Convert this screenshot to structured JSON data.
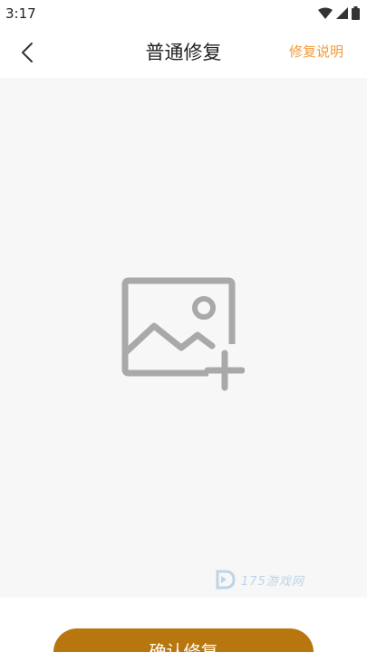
{
  "status_bar": {
    "time": "3:17",
    "icons": [
      "wifi-icon",
      "signal-icon",
      "battery-icon"
    ]
  },
  "header": {
    "back_icon": "chevron-left-icon",
    "title": "普通修复",
    "help_link": "修复说明"
  },
  "upload": {
    "icon": "add-image-icon"
  },
  "watermark": {
    "text": "175游戏网"
  },
  "actions": {
    "confirm_label": "确认修复"
  },
  "colors": {
    "accent_orange": "#f19a38",
    "button_brown": "#b8760f",
    "upload_bg": "#f7f7f7",
    "icon_gray": "#a9a9a9"
  }
}
